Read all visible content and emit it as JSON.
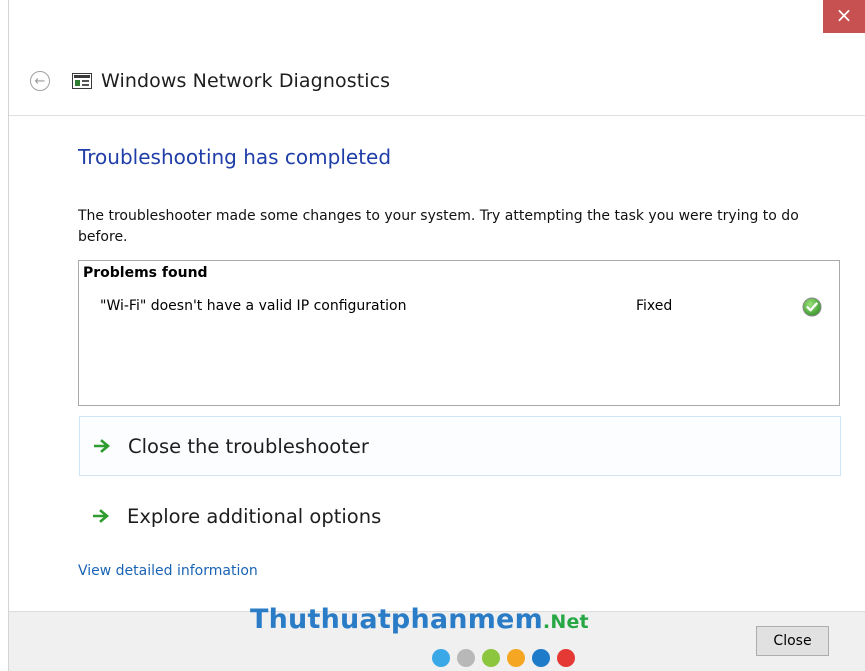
{
  "window": {
    "title": "Windows Network Diagnostics",
    "close_glyph": "×"
  },
  "main": {
    "heading": "Troubleshooting has completed",
    "description": "The troubleshooter made some changes to your system. Try attempting the task you were trying to do before.",
    "problems": {
      "title": "Problems found",
      "items": [
        {
          "text": "\"Wi-Fi\" doesn't have a valid IP configuration",
          "status": "Fixed",
          "icon": "check-icon"
        }
      ]
    },
    "options": [
      {
        "label": "Close the troubleshooter",
        "icon": "arrow-right-icon"
      },
      {
        "label": "Explore additional options",
        "icon": "arrow-right-icon"
      }
    ],
    "detail_link": "View detailed information"
  },
  "footer": {
    "close_label": "Close",
    "watermark": {
      "main": "Thuthuatphanmem",
      "suffix": ".Net"
    },
    "dot_colors": [
      "#3aa8e6",
      "#b8b8b8",
      "#8cc63f",
      "#f5a623",
      "#1e7bc9",
      "#e53935"
    ]
  },
  "colors": {
    "heading": "#1f3ea8",
    "link": "#1a64b5",
    "titlebar_close": "#c75050",
    "check": "#43a047",
    "arrow": "#2e9c2e"
  }
}
